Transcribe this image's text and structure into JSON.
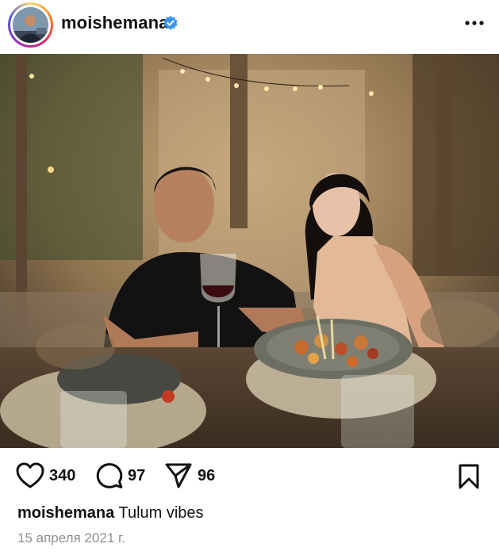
{
  "post": {
    "username": "moishemana",
    "verified": true,
    "likes": "340",
    "comments": "97",
    "shares": "96",
    "caption_username": "moishemana",
    "caption_text": "Tulum vibes",
    "date": "15 апреля 2021 г."
  },
  "icons": {
    "verified": "verified-badge-icon",
    "more": "more-options-icon",
    "like": "heart-icon",
    "comment": "comment-icon",
    "share": "send-icon",
    "save": "bookmark-icon"
  },
  "colors": {
    "verified": "#3897f0",
    "text": "#111111",
    "muted": "#8e8e8e"
  }
}
